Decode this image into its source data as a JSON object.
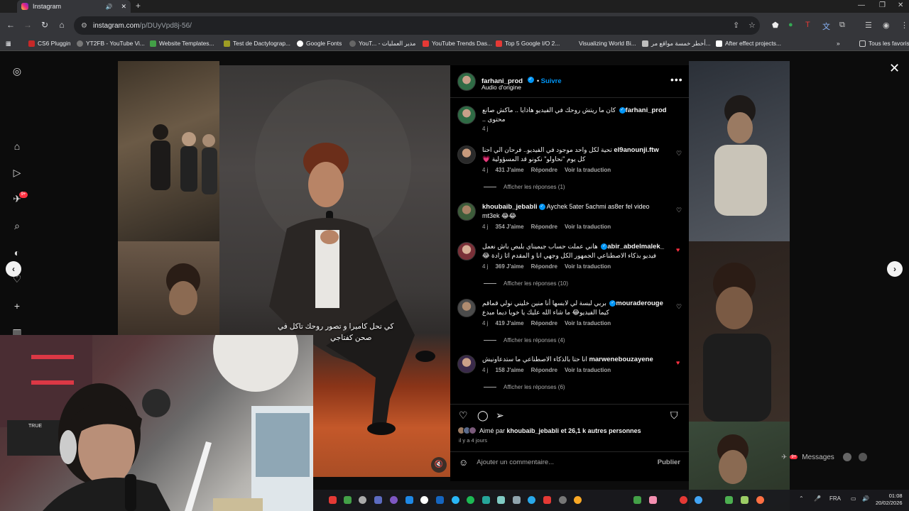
{
  "browser": {
    "tab_title": "Instagram",
    "url_main": "instagram.com",
    "url_path": "/p/DUyVpd8j-56/",
    "bookmarks": [
      "CS6 Pluggin",
      "YT2FB - YouTube Vi...",
      "Website Templates...",
      "Test de Dactylograp...",
      "Google Fonts",
      "YouT... - مدير العمليات",
      "YouTube Trends Das...",
      "Top 5 Google I/O 2...",
      "Visualizing World Bi...",
      "أخطر خمسة مواقع مر...",
      "After effect projects..."
    ],
    "bookmarks_folder": "Tous les favoris"
  },
  "post": {
    "author": "farhani_prod",
    "follow_label": "Suivre",
    "audio": "Audio d'origine",
    "caption_line1": "كي تحل كاميرا و تصور روحك تاكل في",
    "caption_line2": "صحن كفتاجي",
    "author_comment": {
      "user": "farhani_prod",
      "text": "كان ما ريتش روحك في الفيديو هاذايا .. ماكش صانع محتوى ..",
      "age": "4 j"
    },
    "comments": [
      {
        "user": "el9anounji.ftw",
        "text": "تحية لكل واحد موجود في الفيديو.. فرحان الي احنا كل يوم \"نحاولو\" نكونو قد المسؤولية 💗",
        "age": "4 j",
        "likes": "431 J'aime",
        "reply": "Répondre",
        "translate": "Voir la traduction",
        "replies": "Afficher les réponses (1)"
      },
      {
        "user": "khoubaib_jebabli",
        "text": "Aychek 5ater 5achmi as8er fel video mt3ek 😂😂",
        "age": "4 j",
        "likes": "354 J'aime",
        "reply": "Répondre",
        "translate": "Voir la traduction",
        "replies": ""
      },
      {
        "user": "abir_abdelmalek_",
        "text": "هاني عملت حساب جيميناي بليص باش نعمل فيديو بذكاء الاصطناعي الجمهور الكل وجهي انا و المقدم اثا زادة 😂",
        "age": "4 j",
        "likes": "369 J'aime",
        "reply": "Répondre",
        "translate": "Voir la traduction",
        "replies": "Afficher les réponses (10)"
      },
      {
        "user": "mouraderouge",
        "text": "بربي لبسة لي لابسها أنا منين خليني نولي قماقم كيما الفيديو😂 ما شاء الله عليك يا خويا ديما مبدع",
        "age": "4 j",
        "likes": "419 J'aime",
        "reply": "Répondre",
        "translate": "Voir la traduction",
        "replies": "Afficher les réponses (4)"
      },
      {
        "user": "marwenebouzayene",
        "text": "انا حتا بالذكاء الاصطناعي ما ستدعاونيش",
        "age": "4 j",
        "likes": "158 J'aime",
        "reply": "Répondre",
        "translate": "Voir la traduction",
        "replies": "Afficher les réponses (6)"
      }
    ],
    "liked_by_prefix": "Aimé par",
    "liked_by_user": "khoubaib_jebabli",
    "liked_by_suffix": "et 26,1 k autres personnes",
    "posted_ago": "il y a 4 jours",
    "comment_placeholder": "Ajouter un commentaire...",
    "publish_label": "Publier"
  },
  "side_ui": {
    "messages_label": "Messages",
    "nav_badge": "9+",
    "messages_badge": "9+"
  },
  "taskbar": {
    "lang": "FRA",
    "time": "01:08",
    "date": "20/02/2026"
  },
  "colors": {
    "accent": "#0095f6",
    "like_red": "#ff3040",
    "panel_bg": "#000000"
  }
}
